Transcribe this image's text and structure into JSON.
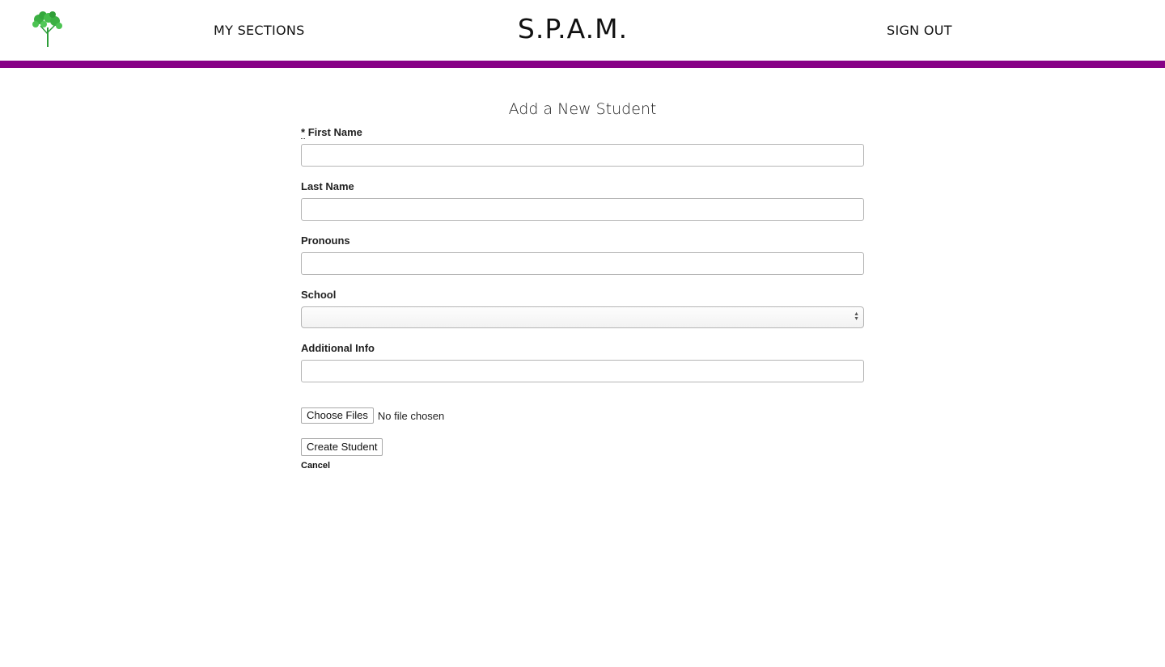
{
  "header": {
    "logo_name": "parsley-logo",
    "nav_sections": "MY SECTIONS",
    "brand": "S.P.A.M.",
    "nav_signout": "SIGN OUT",
    "accent_color": "#870086"
  },
  "form": {
    "title": "Add a New Student",
    "required_marker": "*",
    "first_name_label": "First Name",
    "first_name_value": "",
    "last_name_label": "Last Name",
    "last_name_value": "",
    "pronouns_label": "Pronouns",
    "pronouns_value": "",
    "school_label": "School",
    "school_selected": "",
    "additional_info_label": "Additional Info",
    "additional_info_value": "",
    "choose_files_label": "Choose Files",
    "file_status": "No file chosen",
    "create_label": "Create Student",
    "cancel_label": "Cancel"
  }
}
